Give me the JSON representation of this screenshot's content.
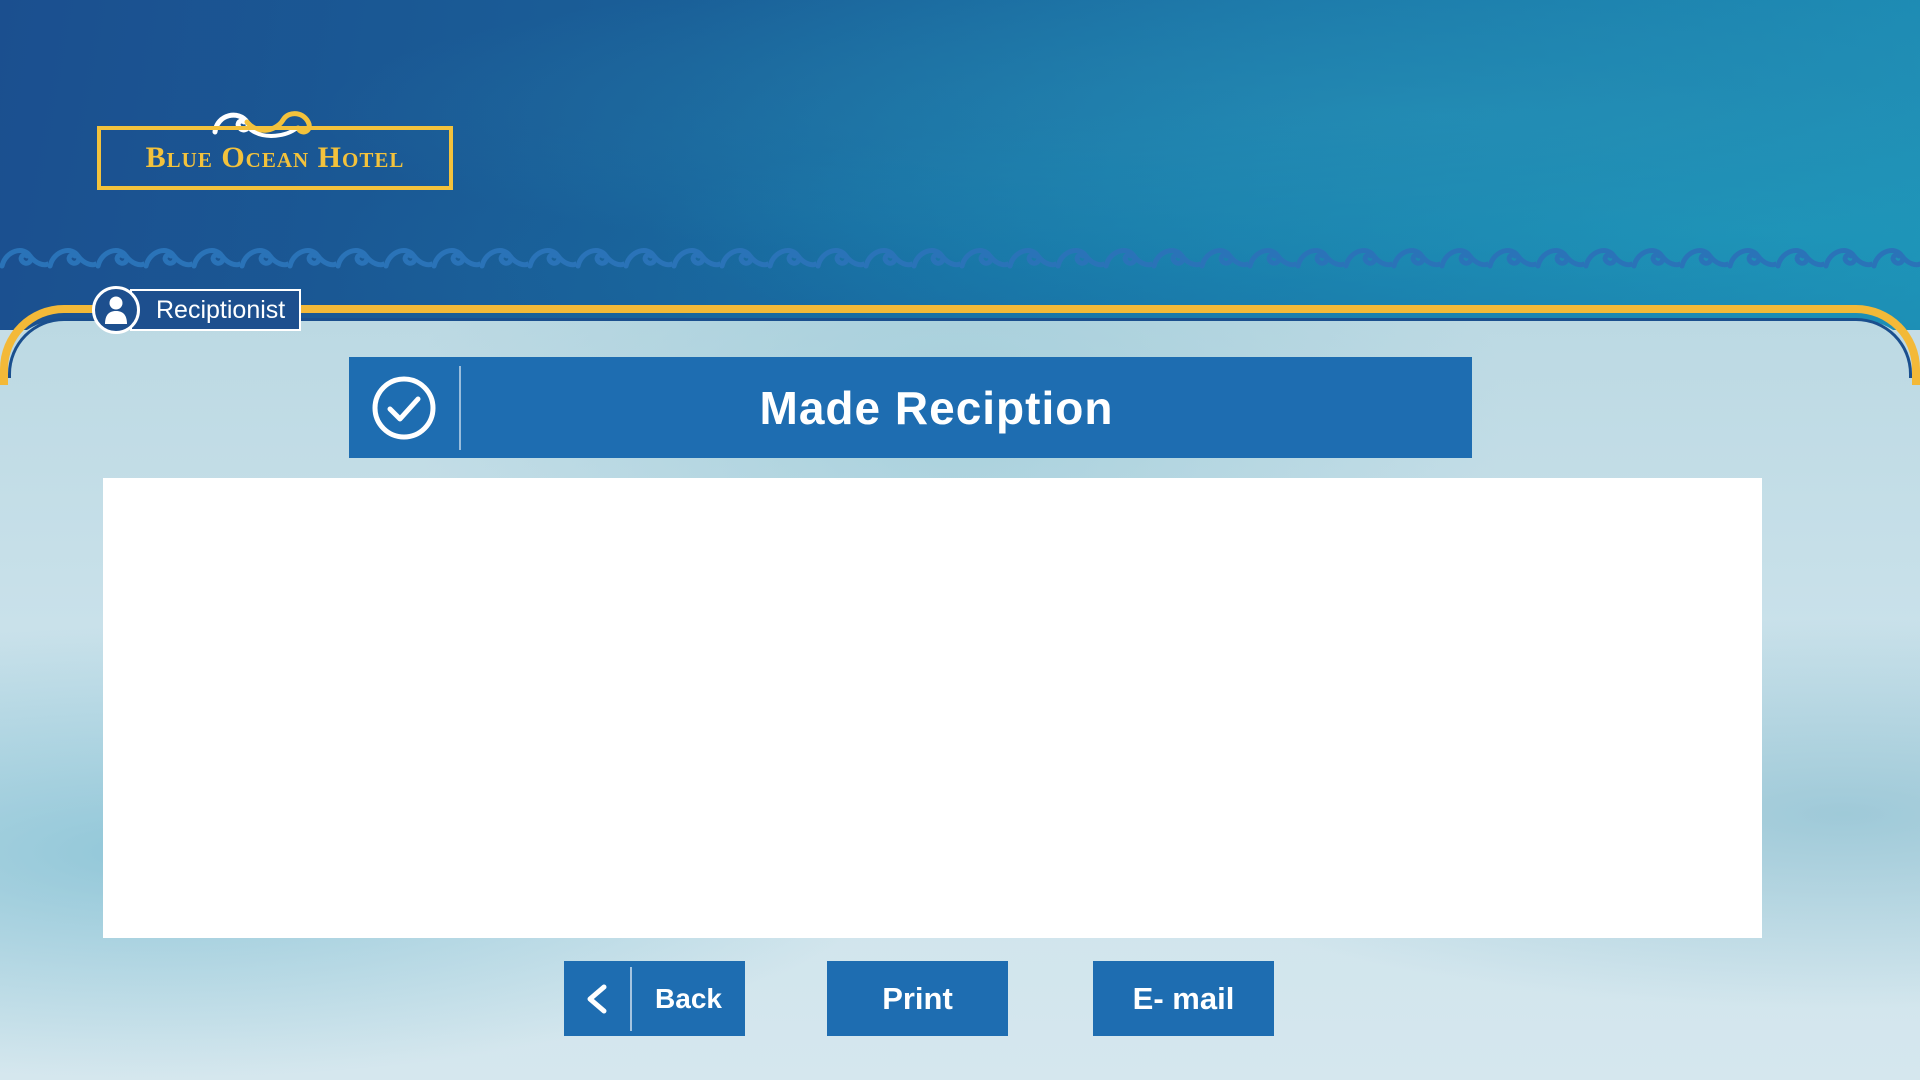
{
  "brand": {
    "name": "Blue Ocean Hotel",
    "gold": "#f3c23c",
    "navy": "#1d4f8e",
    "accent_blue": "#1e6db1"
  },
  "user": {
    "role": "Reciptionist",
    "icon": "person-icon"
  },
  "title_bar": {
    "title": "Made Reciption",
    "icon": "check-circle-icon"
  },
  "content": {
    "icon": ""
  },
  "actions": {
    "back_label": "Back",
    "back_icon": "chevron-left-icon",
    "print_label": "Print",
    "email_label": "E- mail"
  }
}
